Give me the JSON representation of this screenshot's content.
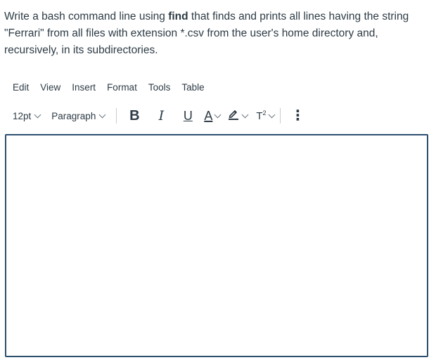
{
  "question": {
    "part1": "Write a bash command line using ",
    "bold": "find",
    "part2": " that finds and prints all lines having the string \"Ferrari\" from all files with extension *.csv from the user's home directory and, recursively, in its subdirectories."
  },
  "menubar": {
    "items": [
      "Edit",
      "View",
      "Insert",
      "Format",
      "Tools",
      "Table"
    ]
  },
  "toolbar": {
    "font_size": "12pt",
    "block_format": "Paragraph",
    "bold_glyph": "B",
    "italic_glyph": "I",
    "underline_glyph": "U",
    "font_color_glyph": "A",
    "superscript_glyph": "T",
    "superscript_mark": "2",
    "more_glyph": "⋮"
  },
  "editor": {
    "content": ""
  },
  "colors": {
    "text": "#2d3b45",
    "editor_border": "#2d4f6e",
    "separator": "#c7cdd1"
  }
}
